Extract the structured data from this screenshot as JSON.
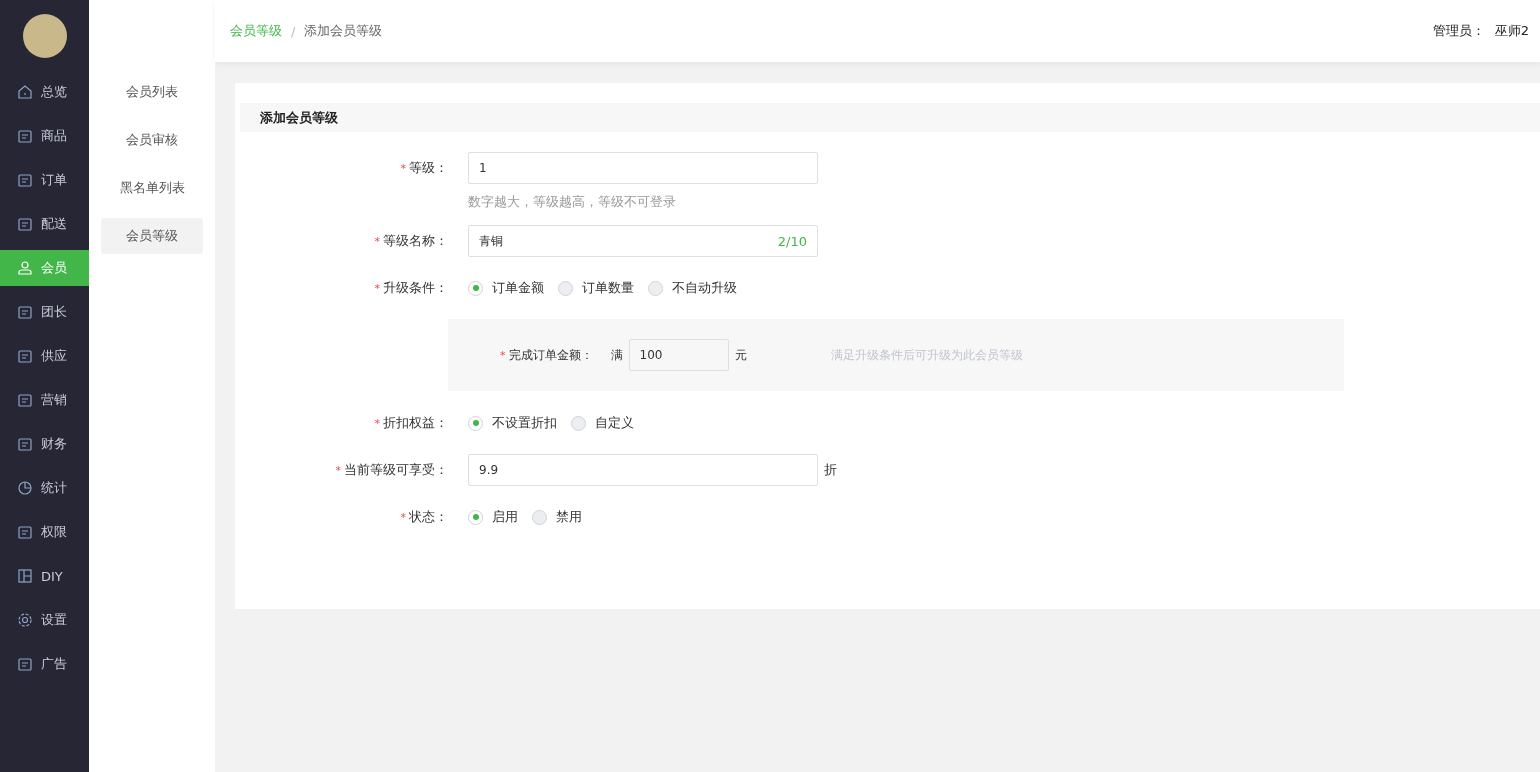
{
  "nav": [
    {
      "label": "总览",
      "selected": false
    },
    {
      "label": "商品",
      "selected": false
    },
    {
      "label": "订单",
      "selected": false
    },
    {
      "label": "配送",
      "selected": false
    },
    {
      "label": "会员",
      "selected": true
    },
    {
      "label": "团长",
      "selected": false
    },
    {
      "label": "供应",
      "selected": false
    },
    {
      "label": "营销",
      "selected": false
    },
    {
      "label": "财务",
      "selected": false
    },
    {
      "label": "统计",
      "selected": false
    },
    {
      "label": "权限",
      "selected": false
    },
    {
      "label": "DIY",
      "selected": false
    },
    {
      "label": "设置",
      "selected": false
    },
    {
      "label": "广告",
      "selected": false
    }
  ],
  "submenu": [
    {
      "label": "会员列表",
      "selected": false
    },
    {
      "label": "会员审核",
      "selected": false
    },
    {
      "label": "黑名单列表",
      "selected": false
    },
    {
      "label": "会员等级",
      "selected": true
    }
  ],
  "breadcrumb": [
    "会员等级",
    "添加会员等级"
  ],
  "breadcrumb_separator": "/",
  "admin": {
    "label": "管理员：",
    "name": "巫师2"
  },
  "form": {
    "title": "添加会员等级",
    "fields": [
      {
        "kind": "input",
        "required_mark": "*",
        "label": "等级：",
        "value": "1",
        "hint": "数字越大，等级越高，等级不可登录"
      },
      {
        "kind": "input",
        "required_mark": "*",
        "label": "等级名称：",
        "value": "青铜",
        "counter": "2/10"
      },
      {
        "kind": "radio",
        "required_mark": "*",
        "label": "升级条件：",
        "options": [
          {
            "label": "订单金额",
            "selected": true
          },
          {
            "label": "订单数量",
            "selected": false
          },
          {
            "label": "不自动升级",
            "selected": false
          }
        ]
      },
      {
        "kind": "panel",
        "required_mark": "*",
        "label": "完成订单金额：",
        "prefix": "满",
        "value": "100",
        "suffix": "元",
        "note": "满足升级条件后可升级为此会员等级"
      },
      {
        "kind": "radio",
        "required_mark": "*",
        "label": "折扣权益：",
        "options": [
          {
            "label": "不设置折扣",
            "selected": true
          },
          {
            "label": "自定义",
            "selected": false
          }
        ]
      },
      {
        "kind": "input",
        "required_mark": "*",
        "label": "当前等级可享受：",
        "value": "9.9",
        "suffix": "折"
      },
      {
        "kind": "radio",
        "required_mark": "*",
        "label": "状态：",
        "options": [
          {
            "label": "启用",
            "selected": true
          },
          {
            "label": "禁用",
            "selected": false
          }
        ]
      }
    ]
  }
}
